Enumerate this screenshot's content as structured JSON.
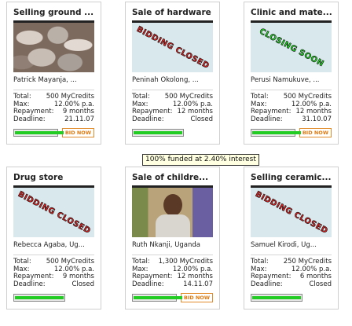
{
  "loans": [
    {
      "title": "Selling ground ...",
      "image": "photo-rocks",
      "stamp": "",
      "owner": "Patrick Mayanja, ...",
      "stats": [
        {
          "label": "Total:",
          "value": "500 MyCredits"
        },
        {
          "label": "Max:",
          "value": "12.00% p.a."
        },
        {
          "label": "Repayment:",
          "value": "9 months"
        },
        {
          "label": "Deadline:",
          "value": "21.11.07"
        }
      ],
      "funded_fraction": 1.0,
      "bid_label": "BID NOW"
    },
    {
      "title": "Sale of hardware",
      "image": "blank",
      "stamp": "BIDDING CLOSED",
      "stamp_kind": "closed",
      "owner": "Peninah Okolong, ...",
      "stats": [
        {
          "label": "Total:",
          "value": "500 MyCredits"
        },
        {
          "label": "Max:",
          "value": "12.00% p.a."
        },
        {
          "label": "Repayment:",
          "value": "12 months"
        },
        {
          "label": "Deadline:",
          "value": "Closed"
        }
      ],
      "funded_fraction": 1.0,
      "bid_label": ""
    },
    {
      "title": "Clinic and mate...",
      "image": "blank",
      "stamp": "CLOSING SOON",
      "stamp_kind": "soon",
      "owner": "Perusi Namukuve, ...",
      "stats": [
        {
          "label": "Total:",
          "value": "500 MyCredits"
        },
        {
          "label": "Max:",
          "value": "12.00% p.a."
        },
        {
          "label": "Repayment:",
          "value": "12 months"
        },
        {
          "label": "Deadline:",
          "value": "31.10.07"
        }
      ],
      "funded_fraction": 1.0,
      "bid_label": "BID NOW"
    },
    {
      "title": "Drug store",
      "image": "blank",
      "stamp": "BIDDING CLOSED",
      "stamp_kind": "closed",
      "owner": "Rebecca Agaba, Ug...",
      "stats": [
        {
          "label": "Total:",
          "value": "500 MyCredits"
        },
        {
          "label": "Max:",
          "value": "12.00% p.a."
        },
        {
          "label": "Repayment:",
          "value": "9 months"
        },
        {
          "label": "Deadline:",
          "value": "Closed"
        }
      ],
      "funded_fraction": 1.0,
      "bid_label": ""
    },
    {
      "title": "Sale of childre...",
      "image": "photo-woman",
      "stamp": "",
      "owner": "Ruth Nkanji, Uganda",
      "stats": [
        {
          "label": "Total:",
          "value": "1,300 MyCredits"
        },
        {
          "label": "Max:",
          "value": "12.00% p.a."
        },
        {
          "label": "Repayment:",
          "value": "12 months"
        },
        {
          "label": "Deadline:",
          "value": "14.11.07"
        }
      ],
      "funded_fraction": 1.0,
      "bid_label": "BID NOW"
    },
    {
      "title": "Selling ceramic...",
      "image": "blank",
      "stamp": "BIDDING CLOSED",
      "stamp_kind": "closed",
      "owner": "Samuel Kirodi, Ug...",
      "stats": [
        {
          "label": "Total:",
          "value": "250 MyCredits"
        },
        {
          "label": "Max:",
          "value": "12.00% p.a."
        },
        {
          "label": "Repayment:",
          "value": "6 months"
        },
        {
          "label": "Deadline:",
          "value": "Closed"
        }
      ],
      "funded_fraction": 1.0,
      "bid_label": ""
    }
  ],
  "tooltip": "100% funded at 2.40% interest",
  "colors": {
    "progress": "#22cc22",
    "closed_stamp": "#e02020",
    "soon_stamp": "#22dd22",
    "bid_button": "#e07a10"
  }
}
